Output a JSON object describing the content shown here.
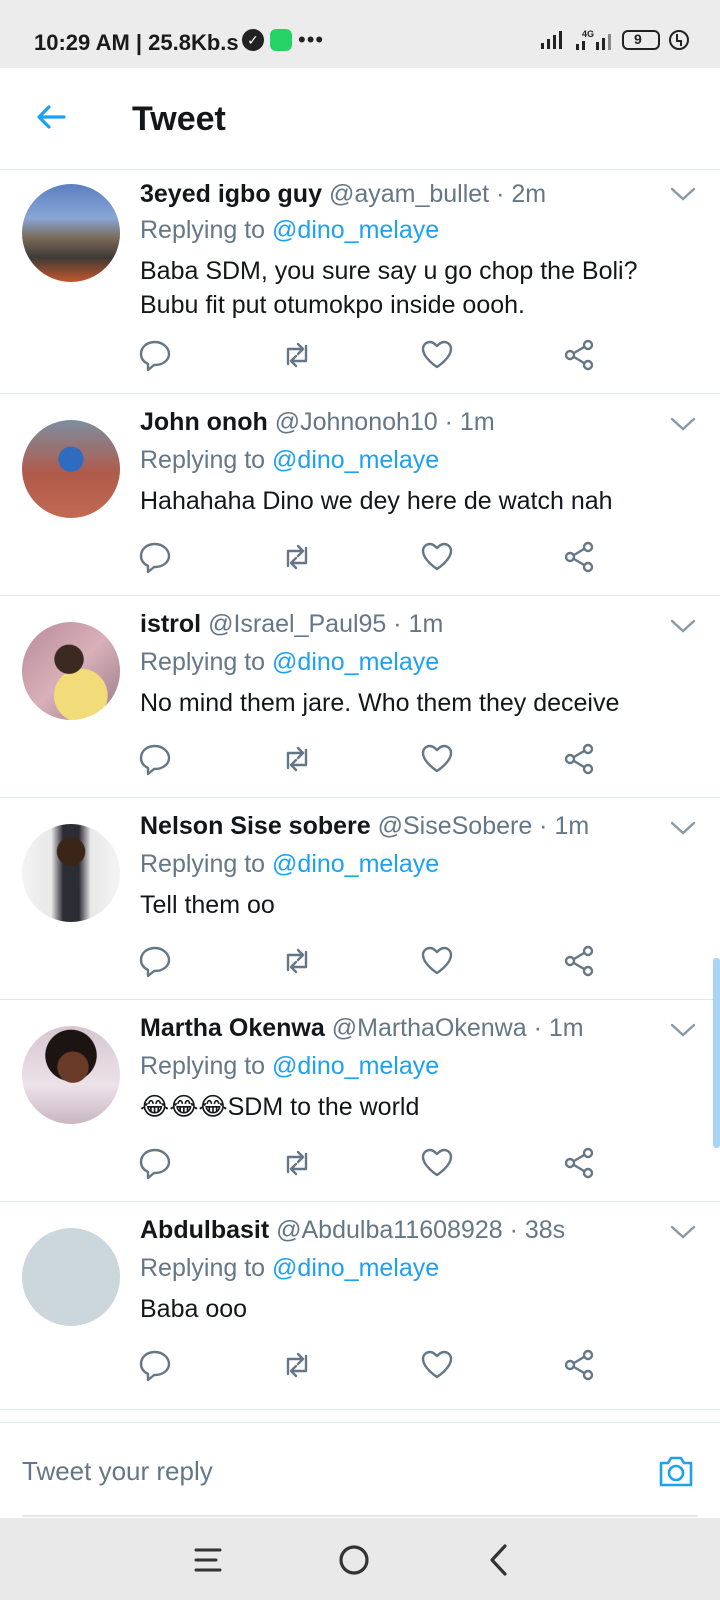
{
  "status_bar": {
    "time": "10:29 AM | 25.8Kb.s",
    "battery": "9",
    "network": "4G"
  },
  "header": {
    "title": "Tweet"
  },
  "tweets": [
    {
      "name": "3eyed igbo guy",
      "handle": "@ayam_bullet · 2m",
      "replying_label": "Replying to ",
      "replying_to": "@dino_melaye",
      "text": "Baba SDM, you sure say u go chop the Boli? Bubu fit put otumokpo inside oooh."
    },
    {
      "name": "John onoh",
      "handle": "@Johnonoh10 · 1m",
      "replying_label": "Replying to ",
      "replying_to": "@dino_melaye",
      "text": "Hahahaha Dino we dey here de watch nah"
    },
    {
      "name": "istrol",
      "handle": "@Israel_Paul95 · 1m",
      "replying_label": "Replying to ",
      "replying_to": "@dino_melaye",
      "text": "No mind them jare. Who them they deceive"
    },
    {
      "name": "Nelson Sise sobere",
      "handle": "@SiseSobere · 1m",
      "replying_label": "Replying to ",
      "replying_to": "@dino_melaye",
      "text": "Tell them oo"
    },
    {
      "name": "Martha Okenwa",
      "handle": "@MarthaOkenwa · 1m",
      "replying_label": "Replying to ",
      "replying_to": "@dino_melaye",
      "text": "😂😂😂SDM to the world"
    },
    {
      "name": "Abdulbasit",
      "handle": "@Abdulba11608928 · 38s",
      "replying_label": "Replying to ",
      "replying_to": "@dino_melaye",
      "text": "Baba ooo"
    }
  ],
  "composer": {
    "placeholder": "Tweet your reply"
  },
  "icons": {
    "back": "arrow-left-icon",
    "reply": "comment-icon",
    "retweet": "retweet-icon",
    "like": "heart-icon",
    "share": "share-icon",
    "more": "chevron-down-icon",
    "camera": "camera-icon"
  },
  "colors": {
    "accent": "#1da1f2",
    "secondary_text": "#657786",
    "primary_text": "#14171a",
    "divider": "#e1e8ed"
  }
}
